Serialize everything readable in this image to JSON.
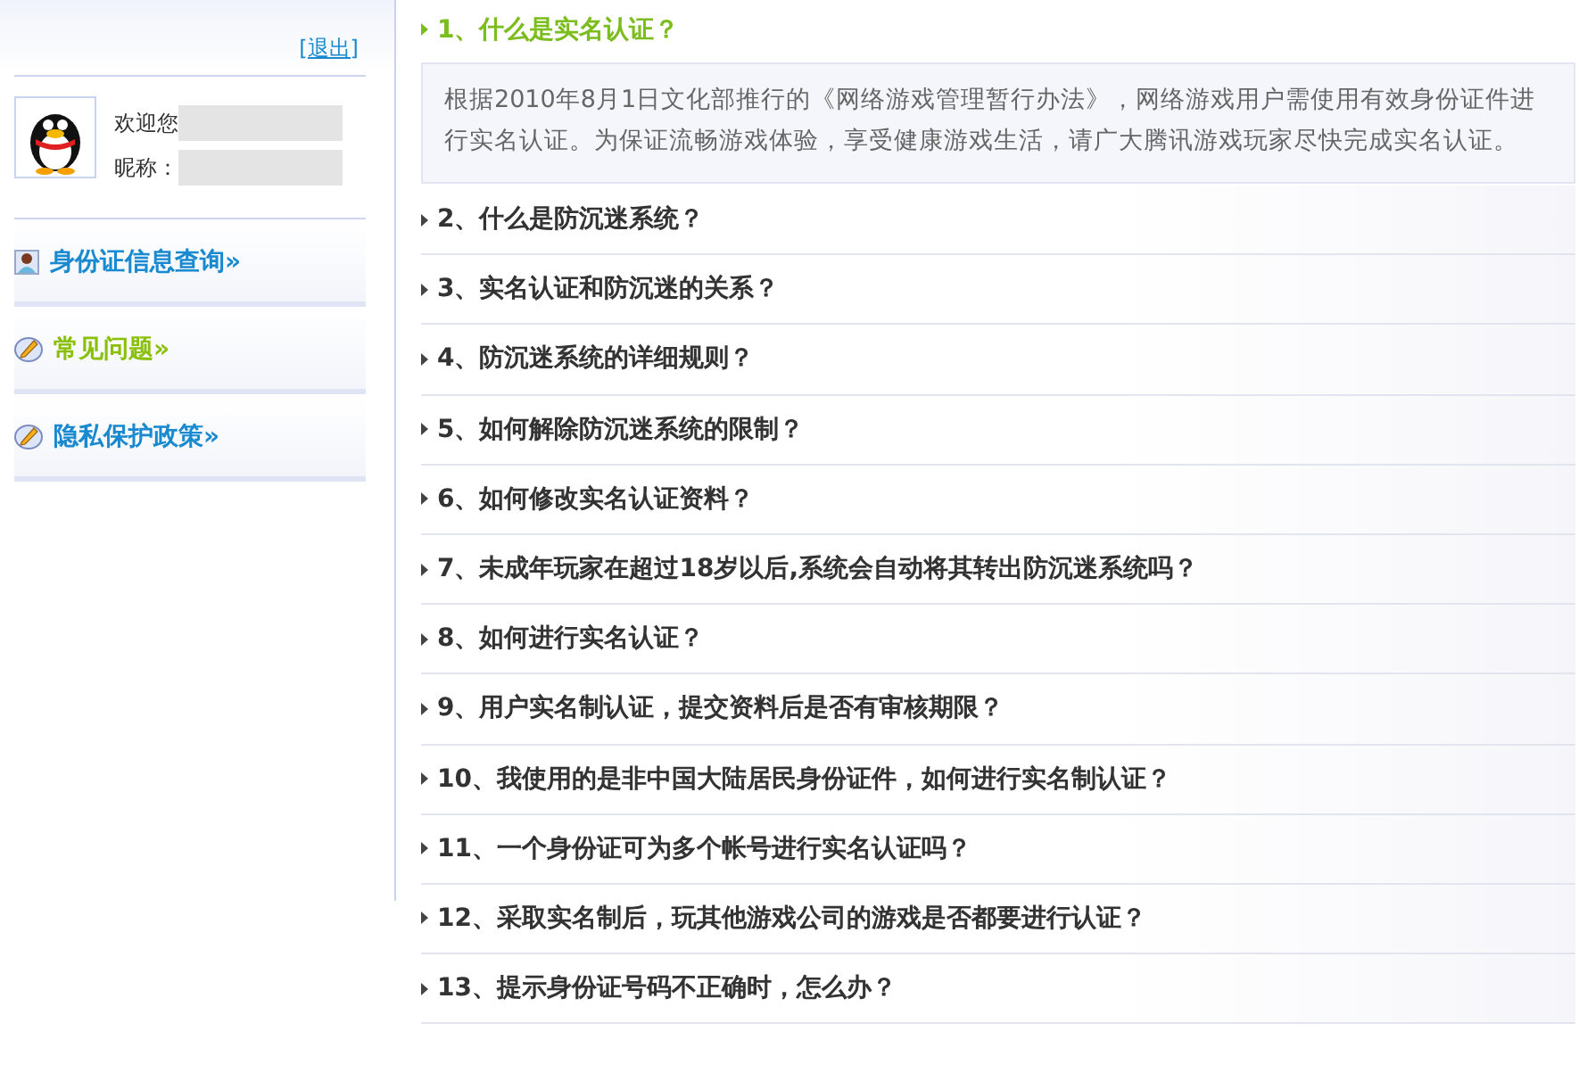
{
  "sidebar": {
    "logout": "[退出]",
    "welcome": "欢迎您",
    "nickname_label": "昵称：",
    "nav": [
      {
        "label": "身份证信息查询»",
        "kind": "person",
        "selected": false
      },
      {
        "label": "常见问题»",
        "kind": "pencil",
        "selected": true
      },
      {
        "label": "隐私保护政策»",
        "kind": "pencil",
        "selected": false
      }
    ]
  },
  "faq": [
    {
      "question": "1、什么是实名认证？",
      "expanded": true,
      "answer": "根据2010年8月1日文化部推行的《网络游戏管理暂行办法》，网络游戏用户需使用有效身份证件进行实名认证。为保证流畅游戏体验，享受健康游戏生活，请广大腾讯游戏玩家尽快完成实名认证。"
    },
    {
      "question": "2、什么是防沉迷系统？",
      "expanded": false
    },
    {
      "question": "3、实名认证和防沉迷的关系？",
      "expanded": false
    },
    {
      "question": "4、防沉迷系统的详细规则？",
      "expanded": false
    },
    {
      "question": "5、如何解除防沉迷系统的限制？",
      "expanded": false
    },
    {
      "question": "6、如何修改实名认证资料？",
      "expanded": false
    },
    {
      "question": "7、未成年玩家在超过18岁以后,系统会自动将其转出防沉迷系统吗？",
      "expanded": false
    },
    {
      "question": "8、如何进行实名认证？",
      "expanded": false
    },
    {
      "question": "9、用户实名制认证，提交资料后是否有审核期限？",
      "expanded": false
    },
    {
      "question": "10、我使用的是非中国大陆居民身份证件，如何进行实名制认证？",
      "expanded": false
    },
    {
      "question": "11、一个身份证可为多个帐号进行实名认证吗？",
      "expanded": false
    },
    {
      "question": "12、采取实名制后，玩其他游戏公司的游戏是否都要进行认证？",
      "expanded": false
    },
    {
      "question": "13、提示身份证号码不正确时，怎么办？",
      "expanded": false
    }
  ]
}
